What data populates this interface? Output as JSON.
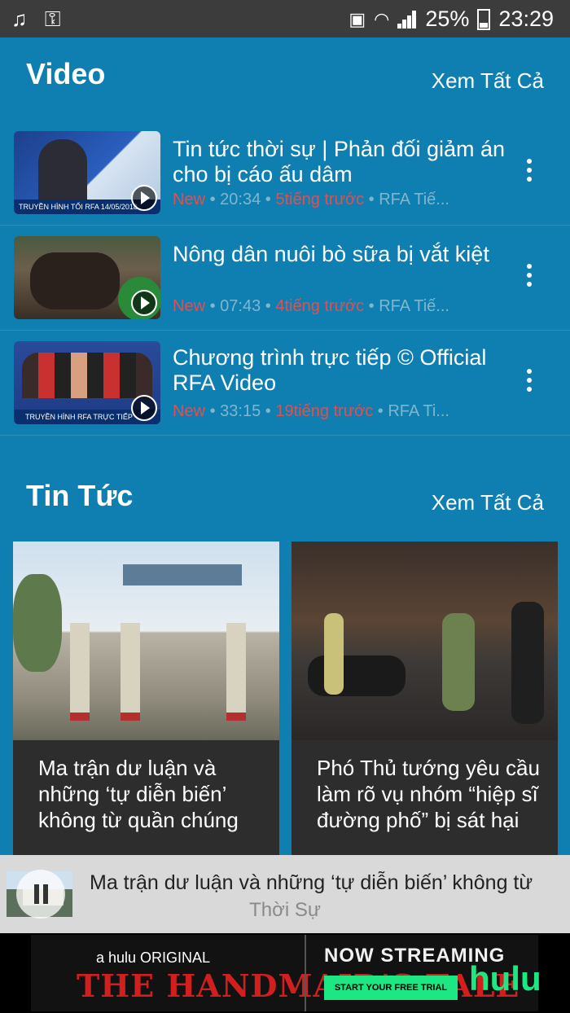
{
  "status_bar": {
    "battery": "25%",
    "time": "23:29"
  },
  "video_section": {
    "title": "Video",
    "see_all": "Xem Tất Cả",
    "items": [
      {
        "title": "Tin tức thời sự | Phản đối giảm án cho bị cáo ấu dâm",
        "badge": "New",
        "duration": "20:34",
        "age": "5tiếng trước",
        "source": "RFA Tiế...",
        "thumb_caption": "TRUYỀN HÌNH TỐI RFA 14/05/2018"
      },
      {
        "title": "Nông dân nuôi bò sữa bị vắt kiệt",
        "badge": "New",
        "duration": "07:43",
        "age": "4tiếng trước",
        "source": "RFA Tiế...",
        "thumb_caption": ""
      },
      {
        "title": "Chương trình trực tiếp © Official RFA Video",
        "badge": "New",
        "duration": "33:15",
        "age": "19tiếng trước",
        "source": "RFA Ti...",
        "thumb_caption": "TRUYỀN HÌNH RFA TRỰC TIẾP"
      }
    ]
  },
  "news_section": {
    "title": "Tin Tức",
    "see_all": "Xem Tất Cả",
    "cards": [
      {
        "title": "Ma trận dư luận và những ‘tự diễn biến’ không từ quần chúng"
      },
      {
        "title": "Phó Thủ tướng yêu cầu làm rõ vụ nhóm “hiệp sĩ đường phố” bị sát hại"
      }
    ]
  },
  "mini_player": {
    "title": "Ma trận dư luận và những ‘tự diễn biến’ không từ",
    "category": "Thời Sự"
  },
  "ad": {
    "brand_small": "a hulu ORIGINAL",
    "show": "THE HANDMAID'S TALE",
    "streaming": "NOW STREAMING",
    "cta": "START YOUR FREE TRIAL",
    "logo": "hulu"
  },
  "colors": {
    "background": "#0e7fb0",
    "accent_red": "#e05050",
    "meta": "#7fb6cf"
  }
}
